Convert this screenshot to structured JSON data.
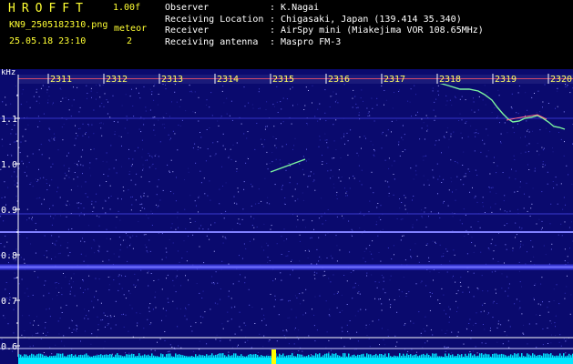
{
  "header": {
    "brand": "HROFFT",
    "version": "1.00f",
    "filename": "KN9_2505182310.png",
    "meteor_label": "meteor",
    "datetime": "25.05.18 23:10",
    "meteor_count": "2"
  },
  "station": [
    {
      "key": "Observer",
      "value": ": K.Nagai"
    },
    {
      "key": "Receiving Location",
      "value": ": Chigasaki, Japan (139.414 35.340)"
    },
    {
      "key": "Receiver",
      "value": ": AirSpy mini (Miakejima VOR 108.65MHz)"
    },
    {
      "key": "Receiving antenna",
      "value": ": Maspro FM-3"
    }
  ],
  "spectrogram": {
    "y_unit": "kHz",
    "y_ticks": [
      "1.1",
      "1.0",
      "0.9",
      "0.8",
      "0.7",
      "0.6"
    ],
    "time_ticks": [
      "2311",
      "2312",
      "2313",
      "2314",
      "2315",
      "2316",
      "2317",
      "2318",
      "2319",
      "2320"
    ],
    "colors": {
      "background": "#0a0a6e",
      "axis": "#ffffff",
      "tick_label": "#ffffff",
      "bar_text": "#ffff66",
      "power_trace": "#00e5ff",
      "marker": "#ffff00",
      "echo": "#7cf5a0"
    }
  }
}
